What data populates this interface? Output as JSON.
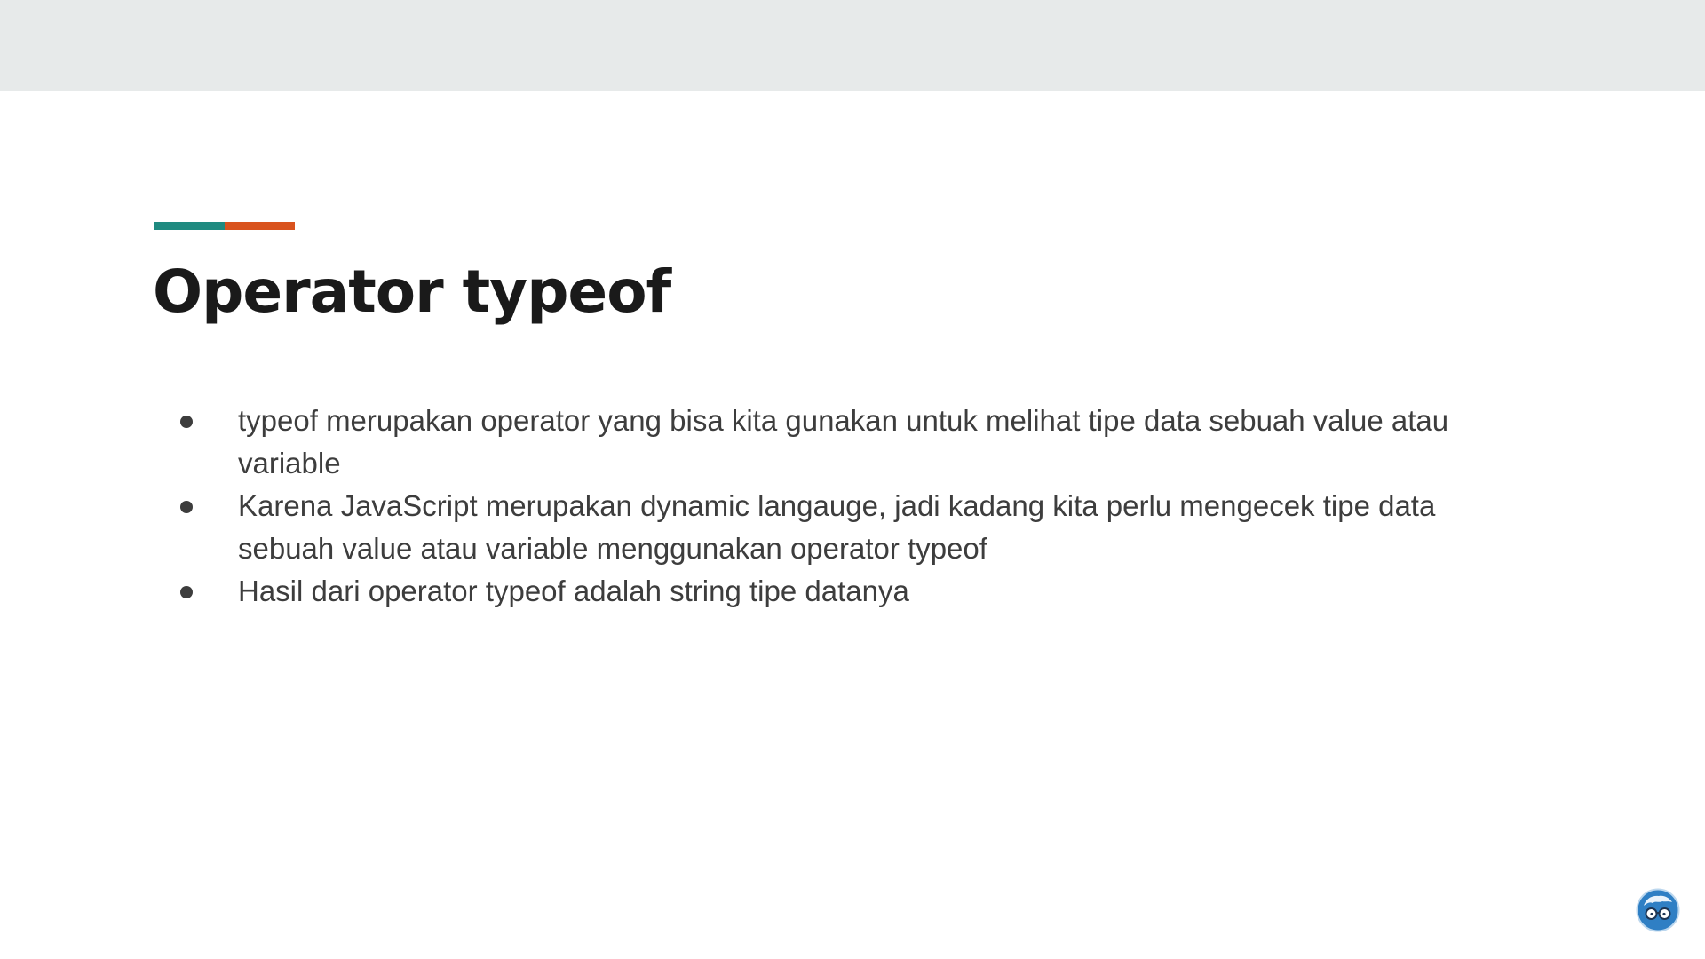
{
  "slide": {
    "title": "Operator typeof",
    "bullets": [
      {
        "text": "typeof merupakan operator yang bisa kita gunakan untuk melihat tipe data sebuah value atau variable"
      },
      {
        "text": "Karena JavaScript merupakan dynamic langauge, jadi kadang kita perlu mengecek tipe data sebuah value atau variable menggunakan operator typeof"
      },
      {
        "text": "Hasil dari operator typeof adalah string tipe datanya"
      }
    ]
  },
  "colors": {
    "accent_teal": "#1f8a80",
    "accent_orange": "#d9531e",
    "title": "#1a1a1a",
    "body_text": "#3d3d3d",
    "top_band": "#e7eaea",
    "logo_blue": "#2f7fc4"
  },
  "icons": {
    "logo": "glasses-mascot-icon"
  }
}
